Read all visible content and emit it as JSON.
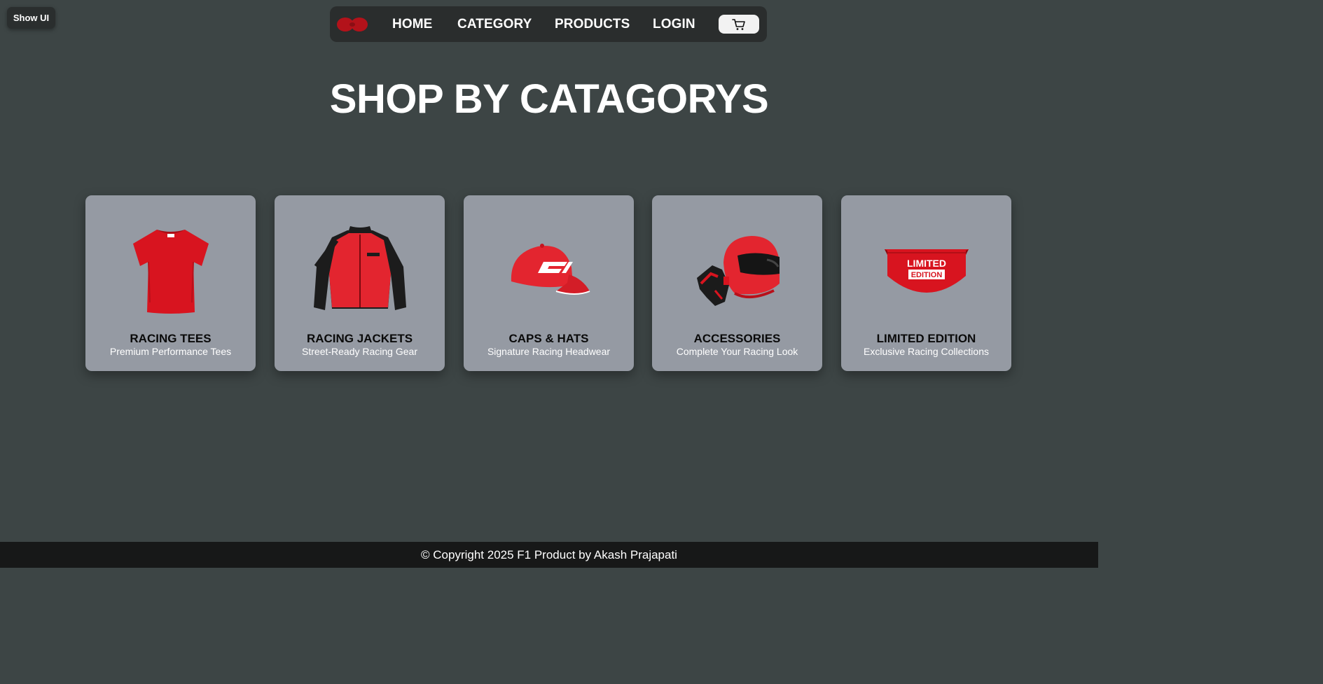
{
  "toolbar": {
    "show_ui_label": "Show UI"
  },
  "nav": {
    "logo_icon": "f1-logo-icon",
    "items": [
      {
        "label": "HOME"
      },
      {
        "label": "CATEGORY"
      },
      {
        "label": "PRODUCTS"
      },
      {
        "label": "LOGIN"
      }
    ],
    "cart_icon": "cart-icon"
  },
  "main": {
    "title": "SHOP BY CATAGORYS",
    "categories": [
      {
        "title": "RACING TEES",
        "subtitle": "Premium Performance Tees",
        "icon": "tshirt-icon"
      },
      {
        "title": "RACING JACKETS",
        "subtitle": "Street-Ready Racing Gear",
        "icon": "jacket-icon"
      },
      {
        "title": "CAPS & HATS",
        "subtitle": "Signature Racing Headwear",
        "icon": "cap-icon"
      },
      {
        "title": "ACCESSORIES",
        "subtitle": "Complete Your Racing Look",
        "icon": "helmet-gloves-icon"
      },
      {
        "title": "LIMITED EDITION",
        "subtitle": "Exclusive Racing Collections",
        "icon": "limited-edition-badge-icon",
        "badge_line1": "LIMITED",
        "badge_line2": "EDITION"
      }
    ]
  },
  "footer": {
    "text": "© Copyright 2025 F1 Product by Akash Prajapati"
  },
  "colors": {
    "background": "#3d4545",
    "navbar": "#2a2d2d",
    "card": "#959aa3",
    "accent_red": "#d8141f",
    "footer": "#171818"
  }
}
